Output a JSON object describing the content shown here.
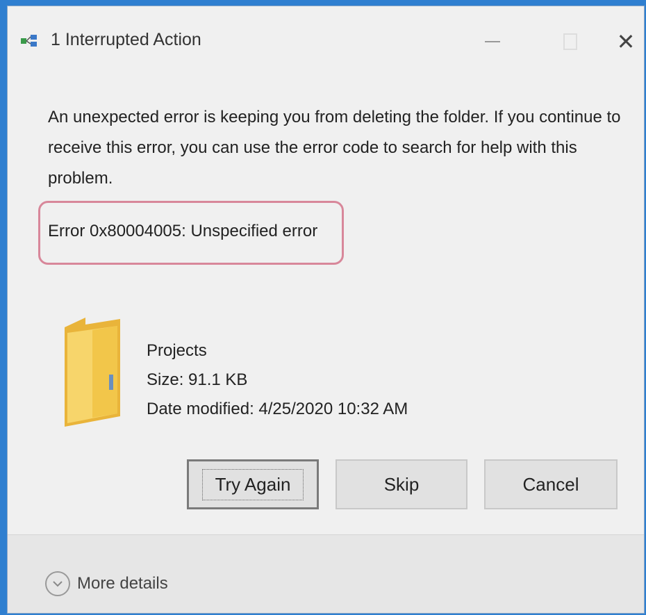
{
  "window": {
    "title": "1 Interrupted Action"
  },
  "dialog": {
    "message": "An unexpected error is keeping you from deleting the folder. If you continue to receive this error, you can use the error code to search for help with this problem.",
    "error": "Error 0x80004005: Unspecified error"
  },
  "item": {
    "name": "Projects",
    "size": "Size: 91.1 KB",
    "date_modified": "Date modified: 4/25/2020 10:32 AM"
  },
  "buttons": {
    "try_again": "Try Again",
    "skip": "Skip",
    "cancel": "Cancel"
  },
  "footer": {
    "more_details": "More details"
  },
  "colors": {
    "highlight_border": "#d8879a",
    "folder": "#f5c84a",
    "desktop": "#2f7fd0"
  },
  "icons": [
    "transfer-icon",
    "minimize-icon",
    "maximize-icon",
    "close-icon",
    "folder-icon",
    "chevron-down-icon"
  ]
}
